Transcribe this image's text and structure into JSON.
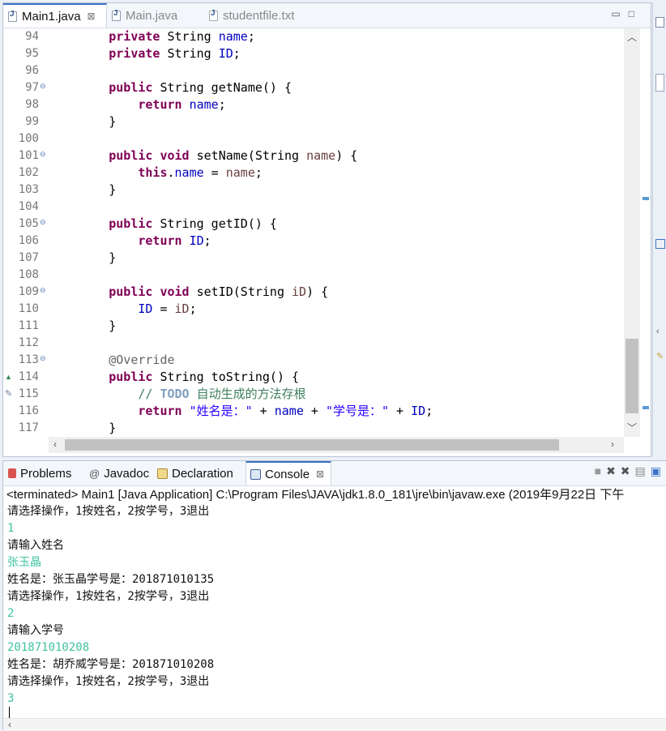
{
  "editor": {
    "tabs": [
      {
        "label": "Main1.java",
        "active": true,
        "close": "⊠"
      },
      {
        "label": "Main.java",
        "active": false
      },
      {
        "label": "studentfile.txt",
        "active": false
      }
    ],
    "window_controls": [
      "minimize-icon",
      "maximize-icon"
    ],
    "line_numbers": [
      "94",
      "95",
      "96",
      "97",
      "98",
      "99",
      "100",
      "101",
      "102",
      "103",
      "104",
      "105",
      "106",
      "107",
      "108",
      "109",
      "110",
      "111",
      "112",
      "113",
      "114",
      "115",
      "116",
      "117"
    ],
    "fold_markers_on": [
      "97",
      "101",
      "105",
      "109",
      "113"
    ]
  },
  "console": {
    "tabs": [
      {
        "label": "Problems",
        "icon": "problems-icon"
      },
      {
        "label": "Javadoc",
        "icon": "at-icon"
      },
      {
        "label": "Declaration",
        "icon": "declaration-icon"
      },
      {
        "label": "Console",
        "icon": "console-icon",
        "active": true,
        "close": "⊠"
      }
    ],
    "status": "<terminated> Main1 [Java Application] C:\\Program Files\\JAVA\\jdk1.8.0_181\\jre\\bin\\javaw.exe (2019年9月22日 下午",
    "lines": [
      {
        "text": "请选择操作，1按姓名，2按学号，3退出",
        "kind": "sys"
      },
      {
        "text": "1",
        "kind": "inp"
      },
      {
        "text": "请输入姓名",
        "kind": "sys"
      },
      {
        "text": "张玉晶",
        "kind": "inp"
      },
      {
        "text": "姓名是：张玉晶学号是：201871010135",
        "kind": "sys"
      },
      {
        "text": "请选择操作，1按姓名，2按学号，3退出",
        "kind": "sys"
      },
      {
        "text": "2",
        "kind": "inp"
      },
      {
        "text": "请输入学号",
        "kind": "sys"
      },
      {
        "text": "201871010208",
        "kind": "inp"
      },
      {
        "text": "姓名是：胡乔威学号是：201871010208",
        "kind": "sys"
      },
      {
        "text": "请选择操作，1按姓名，2按学号，3退出",
        "kind": "sys"
      },
      {
        "text": "3",
        "kind": "inp"
      }
    ]
  },
  "code": {
    "l94": [
      "private",
      "String",
      "name",
      ";"
    ],
    "l95": [
      "private",
      "String",
      "ID",
      ";"
    ],
    "l97": [
      "public",
      "String getName() {"
    ],
    "l98": [
      "return",
      "name",
      ";"
    ],
    "l99": "}",
    "l101": [
      "public void",
      "setName(String ",
      "name",
      ") {"
    ],
    "l102": [
      "this",
      ".",
      "name",
      " = ",
      "name",
      ";"
    ],
    "l103": "}",
    "l105": [
      "public",
      "String getID() {"
    ],
    "l106": [
      "return",
      "ID",
      ";"
    ],
    "l107": "}",
    "l109": [
      "public void",
      "setID(String ",
      "iD",
      ") {"
    ],
    "l110": [
      "ID",
      " = ",
      "iD",
      ";"
    ],
    "l111": "}",
    "l113": "@Override",
    "l114": [
      "public",
      "String toString() {"
    ],
    "l115": [
      "// ",
      "TODO",
      " 自动生成的方法存根"
    ],
    "l116": [
      "return",
      "\"姓名是：\"",
      " + ",
      "name",
      " + ",
      "\"学号是：\"",
      " + ",
      "ID",
      ";"
    ],
    "l117": "}"
  },
  "colors": {
    "keyword": "#7f0055",
    "field": "#0000c0",
    "param": "#6a3e3e",
    "string": "#2a00ff",
    "comment": "#3f7f5f",
    "console_input": "#3fc3a0"
  }
}
